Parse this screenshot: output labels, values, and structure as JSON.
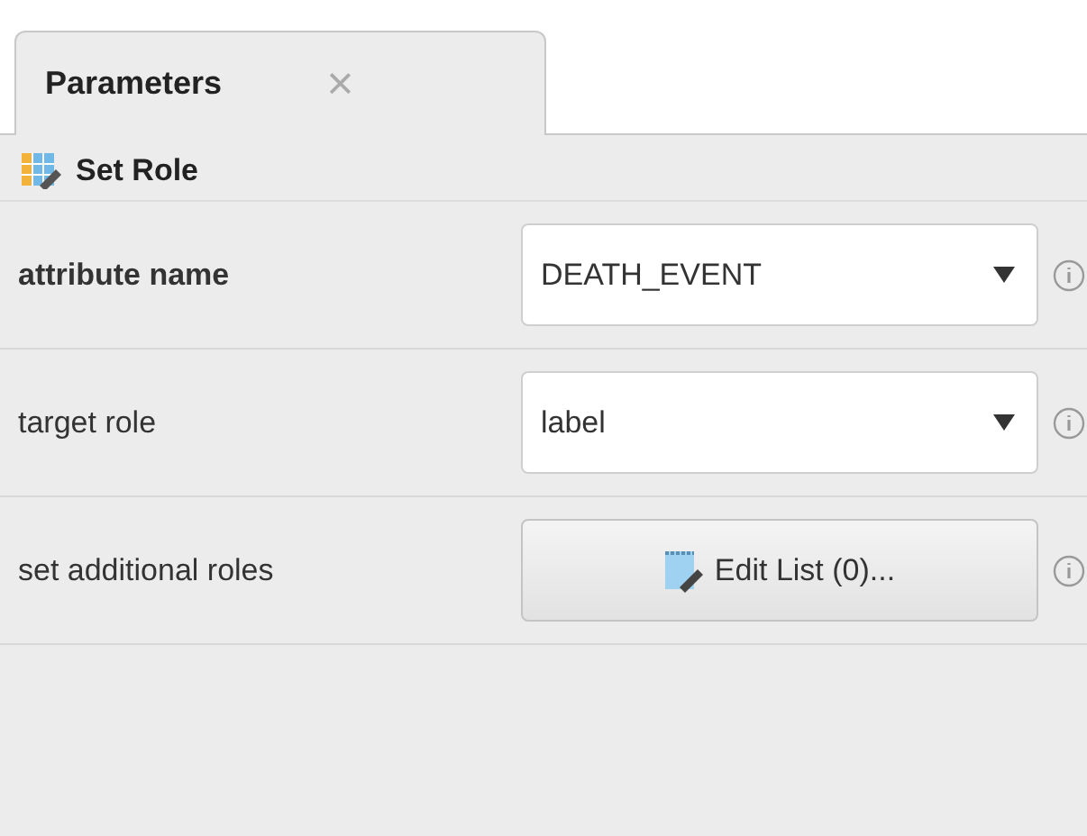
{
  "tab": {
    "label": "Parameters",
    "close": "×",
    "selected": true
  },
  "operator": {
    "name": "Set Role"
  },
  "parameters": [
    {
      "label": "attribute name",
      "required": true,
      "kind": "dropdown",
      "value": "DEATH_EVENT"
    },
    {
      "label": "target role",
      "required": false,
      "kind": "dropdown",
      "value": "label"
    },
    {
      "label": "set additional roles",
      "required": false,
      "kind": "button",
      "value": "Edit List (0)..."
    }
  ]
}
